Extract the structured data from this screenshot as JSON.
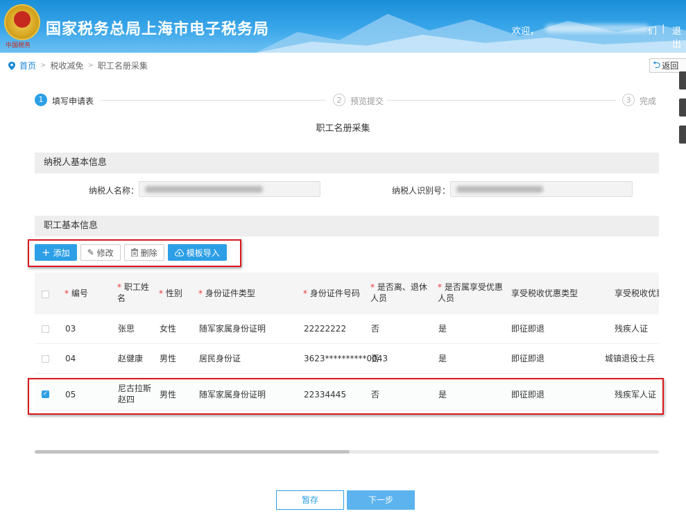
{
  "header": {
    "logo_text": "中国税务",
    "title": "国家税务总局上海市电子税务局",
    "welcome": "欢迎，",
    "user_suffix": "们",
    "separator": "|",
    "logout": "退出"
  },
  "breadcrumb": {
    "home": "首页",
    "sep": ">",
    "level1": "税收减免",
    "level2": "职工名册采集"
  },
  "back_button": "返回",
  "steps": [
    {
      "num": "1",
      "label": "填写申请表"
    },
    {
      "num": "2",
      "label": "预览提交"
    },
    {
      "num": "3",
      "label": "完成"
    }
  ],
  "form_title": "职工名册采集",
  "taxpayer_section": {
    "title": "纳税人基本信息",
    "name_label": "纳税人名称：",
    "id_label": "纳税人识别号："
  },
  "employee_section": {
    "title": "职工基本信息"
  },
  "toolbar": {
    "add": "添加",
    "edit": "修改",
    "delete": "删除",
    "import": "模板导入"
  },
  "table": {
    "headers": [
      {
        "label": "编号",
        "required": true
      },
      {
        "label": "职工姓名",
        "required": true
      },
      {
        "label": "性别",
        "required": true
      },
      {
        "label": "身份证件类型",
        "required": true
      },
      {
        "label": "身份证件号码",
        "required": true
      },
      {
        "label": "是否离、退休人员",
        "required": true
      },
      {
        "label": "是否属享受优惠人员",
        "required": true
      },
      {
        "label": "享受税收优惠类型",
        "required": false
      },
      {
        "label": "享受税收优惠",
        "required": false
      }
    ],
    "rows": [
      {
        "checked": false,
        "no": "03",
        "name": "张思",
        "gender": "女性",
        "id_type": "随军家属身份证明",
        "id_no": "22222222",
        "retired": "否",
        "preferential": "是",
        "type": "即征即退",
        "basis": "残疾人证"
      },
      {
        "checked": false,
        "no": "04",
        "name": "赵健康",
        "gender": "男性",
        "id_type": "居民身份证",
        "id_no": "3623**********0043",
        "retired": "否",
        "preferential": "是",
        "type": "即征即退",
        "basis": "城镇退役士兵"
      },
      {
        "checked": true,
        "no": "05",
        "name": "尼古拉斯赵四",
        "gender": "男性",
        "id_type": "随军家属身份证明",
        "id_no": "22334445",
        "retired": "否",
        "preferential": "是",
        "type": "即征即退",
        "basis": "残疾军人证"
      }
    ]
  },
  "footer": {
    "save": "暂存",
    "next": "下一步"
  },
  "colors": {
    "primary": "#2d9fe6",
    "highlight_box": "#d9161b",
    "required_star": "#ee3333"
  }
}
